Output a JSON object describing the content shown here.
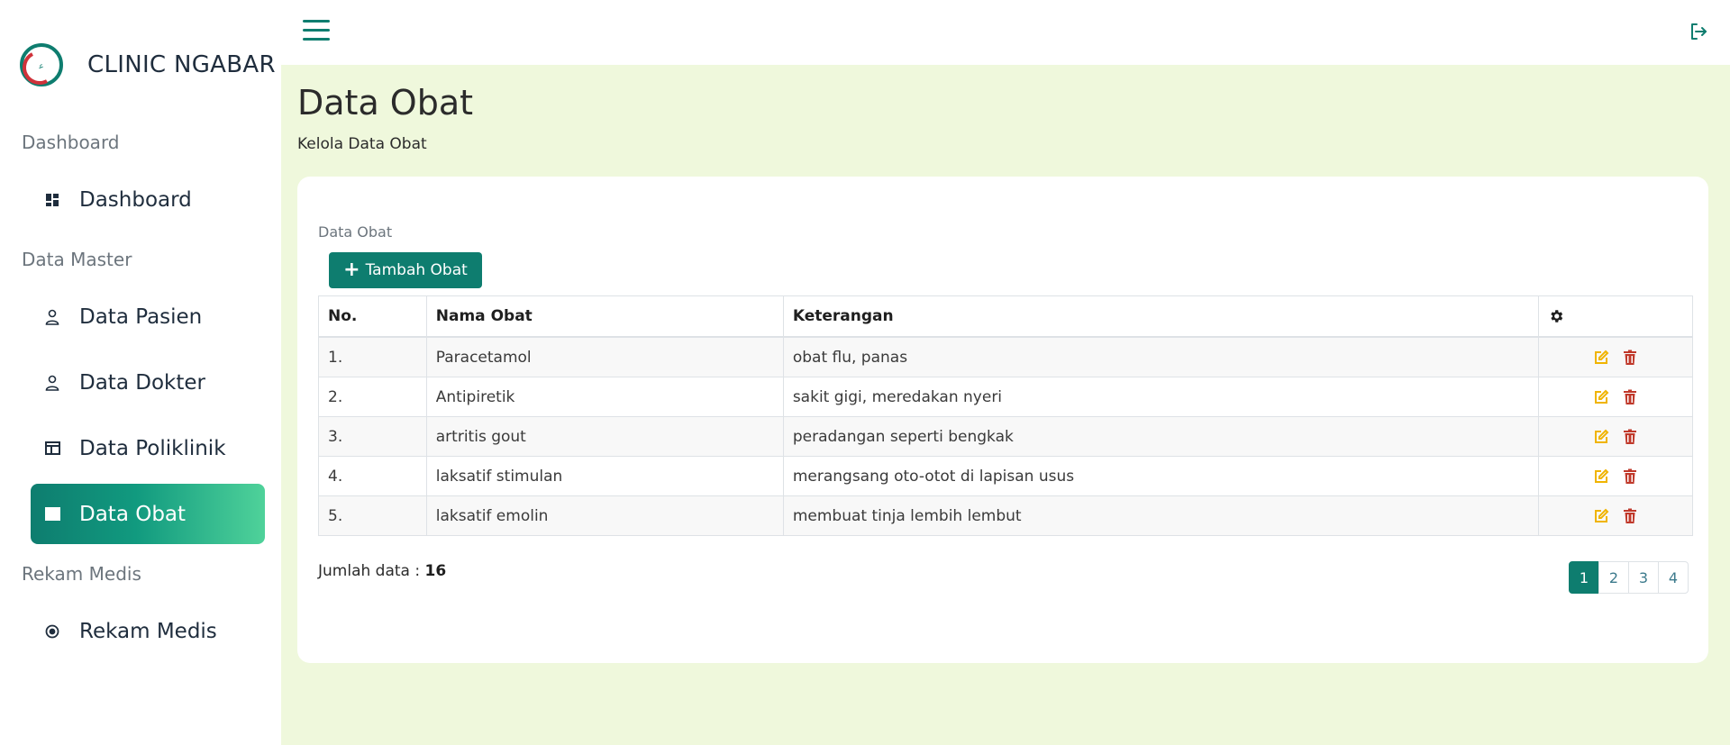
{
  "brand": {
    "name": "CLINIC NGABAR",
    "logo_icon": "clinic-logo"
  },
  "sidebar": {
    "sections": [
      {
        "title": "Dashboard",
        "items": [
          {
            "label": "Dashboard",
            "icon": "grid-icon"
          }
        ]
      },
      {
        "title": "Data Master",
        "items": [
          {
            "label": "Data Pasien",
            "icon": "person-icon"
          },
          {
            "label": "Data Dokter",
            "icon": "person-icon"
          },
          {
            "label": "Data Poliklinik",
            "icon": "table-icon"
          },
          {
            "label": "Data Obat",
            "icon": "table-icon",
            "active": true
          }
        ]
      },
      {
        "title": "Rekam Medis",
        "items": [
          {
            "label": "Rekam Medis",
            "icon": "record-icon"
          }
        ]
      }
    ]
  },
  "topbar": {
    "menu_icon": "hamburger-icon",
    "logout_icon": "logout-icon"
  },
  "page": {
    "title": "Data Obat",
    "subtitle": "Kelola Data Obat"
  },
  "card": {
    "label": "Data Obat",
    "add_button": "Tambah Obat",
    "table": {
      "headers": [
        "No.",
        "Nama Obat",
        "Keterangan"
      ],
      "action_header_icon": "gear-icon",
      "rows": [
        [
          "1.",
          "Paracetamol",
          "obat flu, panas"
        ],
        [
          "2.",
          "Antipiretik",
          "sakit gigi, meredakan nyeri"
        ],
        [
          "3.",
          "artritis gout",
          "peradangan seperti bengkak"
        ],
        [
          "4.",
          "laksatif stimulan",
          "merangsang oto-otot di lapisan usus"
        ],
        [
          "5.",
          "laksatif emolin",
          "membuat tinja lembih lembut"
        ]
      ]
    },
    "total_label": "Jumlah data :",
    "total_value": "16",
    "pagination": [
      "1",
      "2",
      "3",
      "4"
    ],
    "current_page": "1"
  },
  "colors": {
    "primary": "#0e7d6f",
    "accent_gradient_end": "#4fd29a",
    "main_bg": "#eff8dc",
    "edit": "#f0b400",
    "delete": "#c0392b"
  }
}
